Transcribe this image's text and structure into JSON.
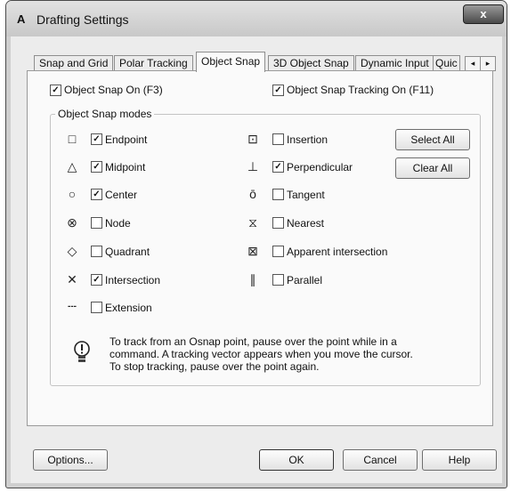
{
  "window": {
    "title": "Drafting Settings",
    "close_label": "x",
    "app_icon": "A"
  },
  "tabs": [
    {
      "label": "Snap and Grid"
    },
    {
      "label": "Polar Tracking"
    },
    {
      "label": "Object Snap"
    },
    {
      "label": "3D Object Snap"
    },
    {
      "label": "Dynamic Input"
    },
    {
      "label": "Quic"
    }
  ],
  "top": {
    "snap_on": {
      "label": "Object Snap On (F3)",
      "checked": true
    },
    "tracking_on": {
      "label": "Object Snap Tracking On (F11)",
      "checked": true
    }
  },
  "modes": {
    "title": "Object Snap modes",
    "left": [
      {
        "label": "Endpoint",
        "checked": true,
        "icon": "square-icon",
        "glyph": "□"
      },
      {
        "label": "Midpoint",
        "checked": true,
        "icon": "triangle-icon",
        "glyph": "△"
      },
      {
        "label": "Center",
        "checked": true,
        "icon": "circle-icon",
        "glyph": "○"
      },
      {
        "label": "Node",
        "checked": false,
        "icon": "node-icon",
        "glyph": "⊗"
      },
      {
        "label": "Quadrant",
        "checked": false,
        "icon": "diamond-icon",
        "glyph": "◇"
      },
      {
        "label": "Intersection",
        "checked": true,
        "icon": "cross-icon",
        "glyph": "✕"
      },
      {
        "label": "Extension",
        "checked": false,
        "icon": "extension-icon",
        "glyph": "---"
      }
    ],
    "right": [
      {
        "label": "Insertion",
        "checked": false,
        "icon": "insertion-icon",
        "glyph": "⊡"
      },
      {
        "label": "Perpendicular",
        "checked": true,
        "icon": "perpendicular-icon",
        "glyph": "⊥"
      },
      {
        "label": "Tangent",
        "checked": false,
        "icon": "tangent-icon",
        "glyph": "ō"
      },
      {
        "label": "Nearest",
        "checked": false,
        "icon": "hourglass-icon",
        "glyph": "⧖"
      },
      {
        "label": "Apparent intersection",
        "checked": false,
        "icon": "apparent-intersection-icon",
        "glyph": "⊠"
      },
      {
        "label": "Parallel",
        "checked": false,
        "icon": "parallel-icon",
        "glyph": "∥"
      }
    ],
    "select_all": "Select All",
    "clear_all": "Clear All"
  },
  "info": {
    "line1": "To track from an Osnap point, pause over the point while in a",
    "line2": "command.  A tracking vector appears when you move the cursor.",
    "line3": "To stop tracking, pause over the point again."
  },
  "footer": {
    "options": "Options...",
    "ok": "OK",
    "cancel": "Cancel",
    "help": "Help"
  }
}
